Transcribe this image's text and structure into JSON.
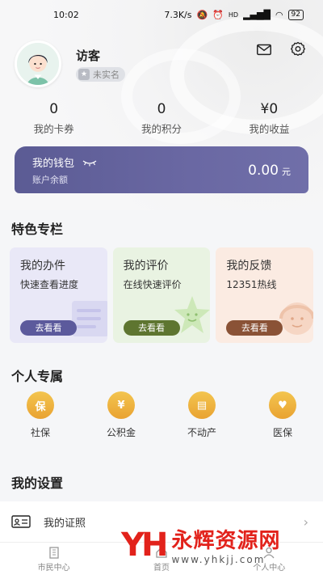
{
  "status_bar": {
    "time": "10:02",
    "network_speed": "7.3K/s",
    "battery": "92",
    "icons": [
      "mute-icon",
      "alarm-icon",
      "hd-icon",
      "signal-icon",
      "wifi-icon",
      "battery-icon"
    ]
  },
  "profile": {
    "username": "访客",
    "verify_status": "未实名"
  },
  "stats": [
    {
      "value": "0",
      "label": "我的卡券"
    },
    {
      "value": "0",
      "label": "我的积分"
    },
    {
      "value": "¥0",
      "label": "我的收益"
    }
  ],
  "wallet": {
    "title": "我的钱包",
    "subtitle": "账户余额",
    "amount": "0.00",
    "unit": "元"
  },
  "featured": {
    "title": "特色专栏",
    "cards": [
      {
        "title": "我的办件",
        "subtitle": "快速查看进度",
        "button": "去看看",
        "bg": "#e9e8f7",
        "btn_color": "#5c5a9c"
      },
      {
        "title": "我的评价",
        "subtitle": "在线快速评价",
        "button": "去看看",
        "bg": "#e9f3e2",
        "btn_color": "#5e7530"
      },
      {
        "title": "我的反馈",
        "subtitle": "12351热线",
        "button": "去看看",
        "bg": "#fbebe2",
        "btn_color": "#8a5236"
      }
    ]
  },
  "personal": {
    "title": "个人专属",
    "items": [
      {
        "label": "社保",
        "icon": "保"
      },
      {
        "label": "公积金",
        "icon": "¥"
      },
      {
        "label": "不动产",
        "icon": "▤"
      },
      {
        "label": "医保",
        "icon": "♥"
      }
    ]
  },
  "settings": {
    "title": "我的设置",
    "items": [
      {
        "label": "我的证照"
      }
    ]
  },
  "bottom_nav": [
    {
      "label": "市民中心"
    },
    {
      "label": "首页"
    },
    {
      "label": "个人中心"
    }
  ],
  "watermark": {
    "logo": "YH",
    "text": "永辉资源网",
    "url": "www.yhkjj.com"
  }
}
